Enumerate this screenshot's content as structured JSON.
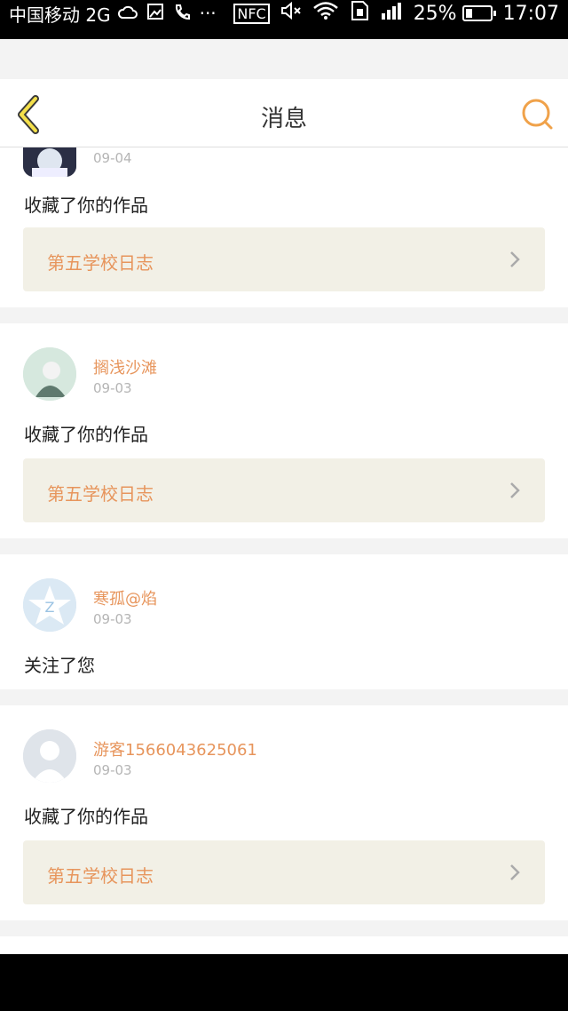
{
  "status_bar": {
    "carrier": "中国移动 2G",
    "nfc_label": "NFC",
    "network_badge": "2G",
    "battery": "25%",
    "battery_level": 0.25,
    "time": "17:07",
    "dots": "···",
    "icons": [
      "cloud-icon",
      "image-icon",
      "phone-icon",
      "more-dots-icon",
      "nfc-icon",
      "mute-icon",
      "wifi-icon",
      "sim-icon",
      "signal-icon",
      "battery-icon"
    ]
  },
  "nav": {
    "title": "消息",
    "back_icon": "chevron-left-icon",
    "search_icon": "search-icon",
    "accent_color": "#f0a24a"
  },
  "messages": [
    {
      "user": "",
      "date": "09-04",
      "action": "收藏了你的作品",
      "work_title": "第五学校日志"
    },
    {
      "user": "搁浅沙滩",
      "date": "09-03",
      "action": "收藏了你的作品",
      "work_title": "第五学校日志"
    },
    {
      "user": "寒孤@焰",
      "date": "09-03",
      "action": "关注了您"
    },
    {
      "user": "游客1566043625061",
      "date": "09-03",
      "action": "收藏了你的作品",
      "work_title": "第五学校日志"
    }
  ],
  "colors": {
    "username": "#e7955c",
    "work_bg": "#f2f0e6",
    "page_bg": "#f3f3f3"
  }
}
